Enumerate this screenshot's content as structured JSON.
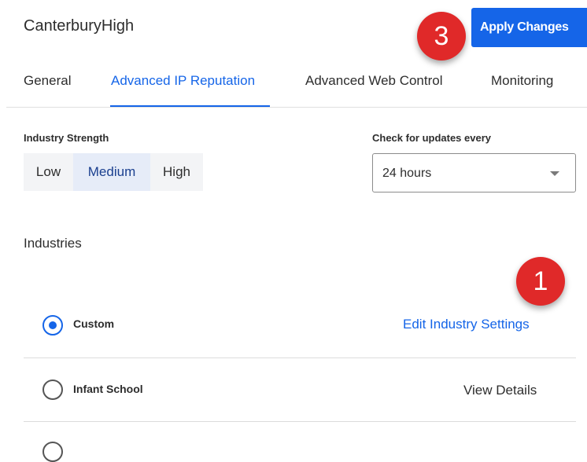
{
  "header": {
    "site_name": "CanterburyHigh",
    "apply_label": "Apply Changes"
  },
  "markers": {
    "apply": "3",
    "edit": "1"
  },
  "tabs": [
    {
      "label": "General"
    },
    {
      "label": "Advanced IP Reputation"
    },
    {
      "label": "Advanced Web Control"
    },
    {
      "label": "Monitoring"
    }
  ],
  "strength": {
    "label": "Industry Strength",
    "options": [
      "Low",
      "Medium",
      "High"
    ],
    "selected": "Medium"
  },
  "updates": {
    "label": "Check for updates every",
    "value": "24 hours"
  },
  "industries": {
    "title": "Industries",
    "rows": [
      {
        "label": "Custom",
        "action": "Edit Industry Settings",
        "checked": true
      },
      {
        "label": "Infant School",
        "action": "View Details",
        "checked": false
      }
    ]
  },
  "colors": {
    "accent": "#1565e8",
    "marker": "#e02929",
    "selected_bg": "#e6ecf8"
  }
}
